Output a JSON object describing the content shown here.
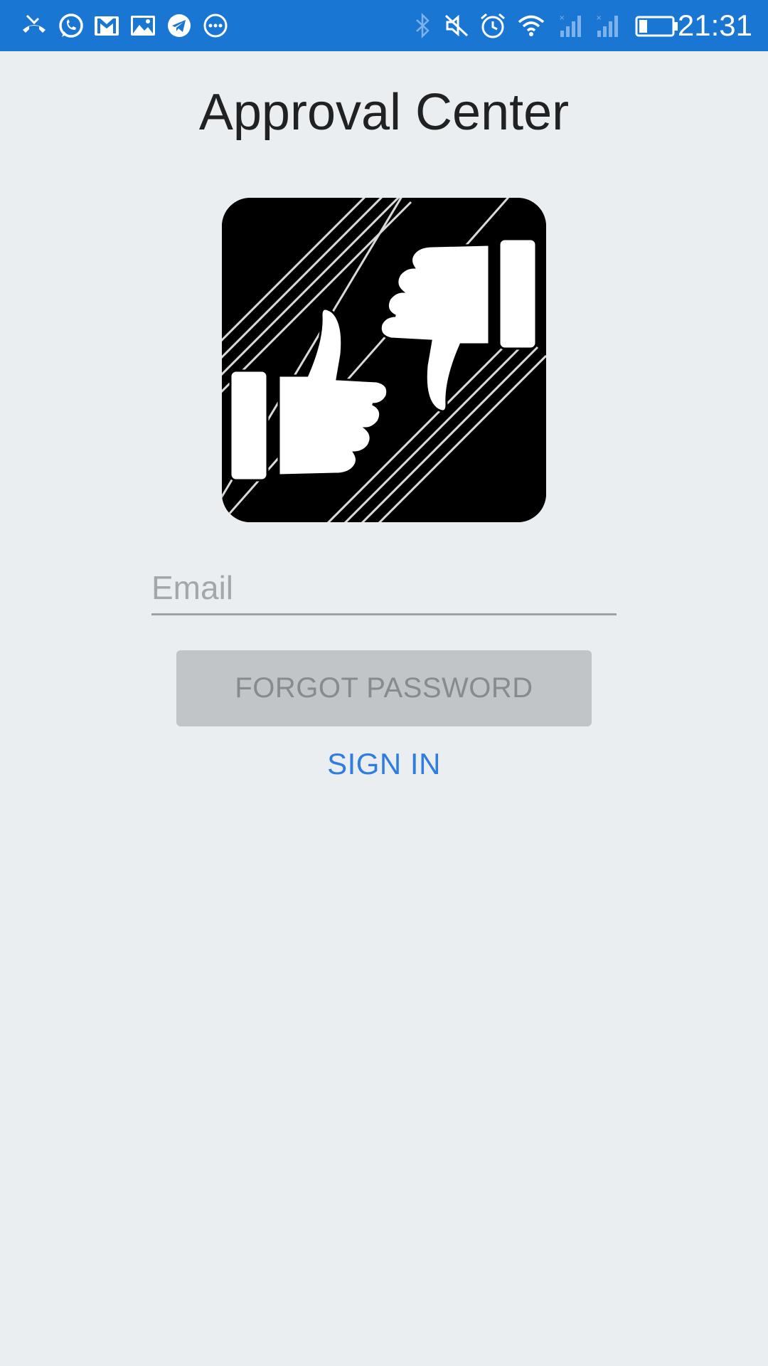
{
  "status_bar": {
    "time": "21:31",
    "left_icons": [
      "missed-call-icon",
      "whatsapp-icon",
      "gmail-icon",
      "gallery-icon",
      "telegram-icon",
      "more-notifications-icon"
    ],
    "right_icons": [
      "bluetooth-icon",
      "mute-icon",
      "alarm-icon",
      "wifi-icon",
      "signal-1-icon",
      "signal-2-icon",
      "battery-icon"
    ],
    "background": "#1976d2"
  },
  "header": {
    "title": "Approval Center"
  },
  "logo": {
    "icon": "thumbs-up-down-icon"
  },
  "form": {
    "email_placeholder": "Email",
    "email_value": "",
    "forgot_password_label": "FORGOT PASSWORD",
    "sign_in_label": "SIGN IN"
  },
  "colors": {
    "accent": "#2f7de1",
    "background": "#ebeef0",
    "button_disabled": "#c2c5c7"
  }
}
